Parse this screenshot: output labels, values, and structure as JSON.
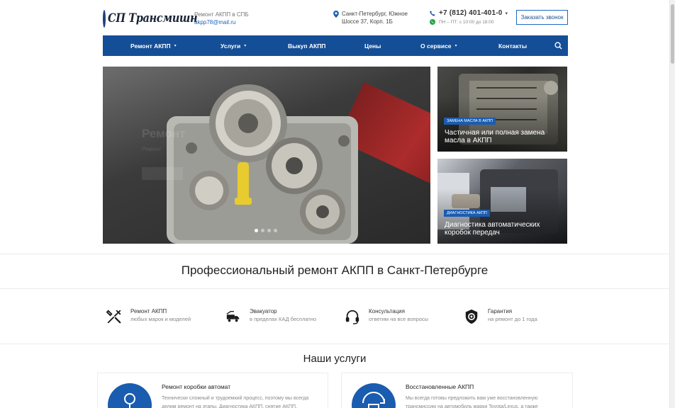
{
  "header": {
    "logo_text": "СП Трансмишн",
    "info_line": "Ремонт АКПП в СПБ",
    "email": "akpp78@mail.ru",
    "address": "Санкт-Петербург, Южное Шоссе 37, Корп. 1Б",
    "phone": "+7 (812) 401-401-0",
    "hours": "ПН – ПТ: с 10:00 до 18:00",
    "cta_label": "Заказать звонок"
  },
  "nav": {
    "items": [
      {
        "label": "Ремонт АКПП",
        "dropdown": true
      },
      {
        "label": "Услуги",
        "dropdown": true
      },
      {
        "label": "Выкуп АКПП",
        "dropdown": false
      },
      {
        "label": "Цены",
        "dropdown": false
      },
      {
        "label": "О сервисе",
        "dropdown": true
      },
      {
        "label": "Контакты",
        "dropdown": false
      }
    ],
    "search_icon": "search-icon"
  },
  "hero": {
    "title": "Ремонт",
    "subtitle": "Ремонт",
    "dots": 4,
    "active_dot": 1
  },
  "cards": [
    {
      "tag": "Замена масла в АКПП",
      "title": "Частичная или полная замена масла в АКПП"
    },
    {
      "tag": "Диагностика АКПП",
      "title": "Диагностика автоматических коробок передач"
    }
  ],
  "section_title": "Профессиональный ремонт АКПП в Санкт-Петербурге",
  "features": [
    {
      "icon": "tools-icon",
      "title": "Ремонт АКПП",
      "sub": "любых марок и моделей"
    },
    {
      "icon": "tow-truck-icon",
      "title": "Эвакуатор",
      "sub": "в пределах КАД бесплатно"
    },
    {
      "icon": "headset-icon",
      "title": "Консультация",
      "sub": "ответим на все вопросы"
    },
    {
      "icon": "shield-icon",
      "title": "Гарантия",
      "sub": "на ремонт до 1 года"
    }
  ],
  "services_title": "Наши услуги",
  "services": [
    {
      "title": "Ремонт коробки автомат",
      "desc": "Технически сложный и трудоемкий процесс, поэтому мы всегда делим ремонт на этапы. Диагностика АКПП, снятие АКПП,"
    },
    {
      "title": "Восстановленные АКПП",
      "desc": "Мы всегда готовы предложить вам уже восстановленную трансмиссию на автомобиль марки Toyota/Lexus, а также"
    }
  ],
  "colors": {
    "brand_blue": "#144e96",
    "accent_blue": "#1a5cb0",
    "logo_red": "#d72a2a"
  }
}
